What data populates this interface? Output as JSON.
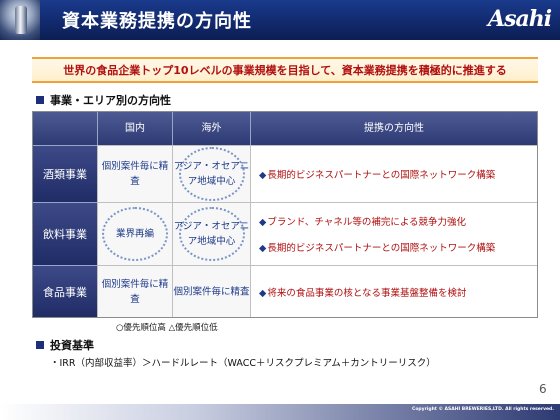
{
  "header": {
    "title": "資本業務提携の方向性",
    "logo": "Asahi"
  },
  "banner": "世界の食品企業トップ10レベルの事業規模を目指して、資本業務提携を積極的に推進する",
  "section1": "事業・エリア別の方向性",
  "matrix": {
    "columns": [
      "国内",
      "海外",
      "提携の方向性"
    ],
    "rows": [
      {
        "label": "酒類事業",
        "domestic": "個別案件毎に精査",
        "domestic_bubble": false,
        "overseas": "アジア・オセアニア地域中心",
        "overseas_bubble": true,
        "directions": [
          "長期的ビジネスパートナーとの国際ネットワーク構築"
        ]
      },
      {
        "label": "飲料事業",
        "domestic": "業界再編",
        "domestic_bubble": true,
        "overseas": "アジア・オセアニア地域中心",
        "overseas_bubble": true,
        "directions": [
          "ブランド、チャネル等の補完による競争力強化",
          "長期的ビジネスパートナーとの国際ネットワーク構築"
        ]
      },
      {
        "label": "食品事業",
        "domestic": "個別案件毎に精査",
        "domestic_bubble": false,
        "overseas": "個別案件毎に精査",
        "overseas_bubble": false,
        "directions": [
          "将来の食品事業の核となる事業基盤整備を検討"
        ]
      }
    ]
  },
  "legend": "○優先順位高 △優先順位低",
  "section2": "投資基準",
  "criteria": "・IRR（内部収益率）＞ハードルレート（WACC＋リスクプレミアム＋カントリーリスク）",
  "page_number": "6",
  "copyright": "Copyright © ASAHI BREWERIES,LTD. All rights reserved.",
  "colors": {
    "header": "#1a3a8c",
    "accent_red": "#b01010",
    "banner_border": "#f0a23a",
    "cell_text": "#1d3a8a"
  },
  "icons": {
    "bullet": "diamond-icon",
    "section": "square-icon"
  }
}
